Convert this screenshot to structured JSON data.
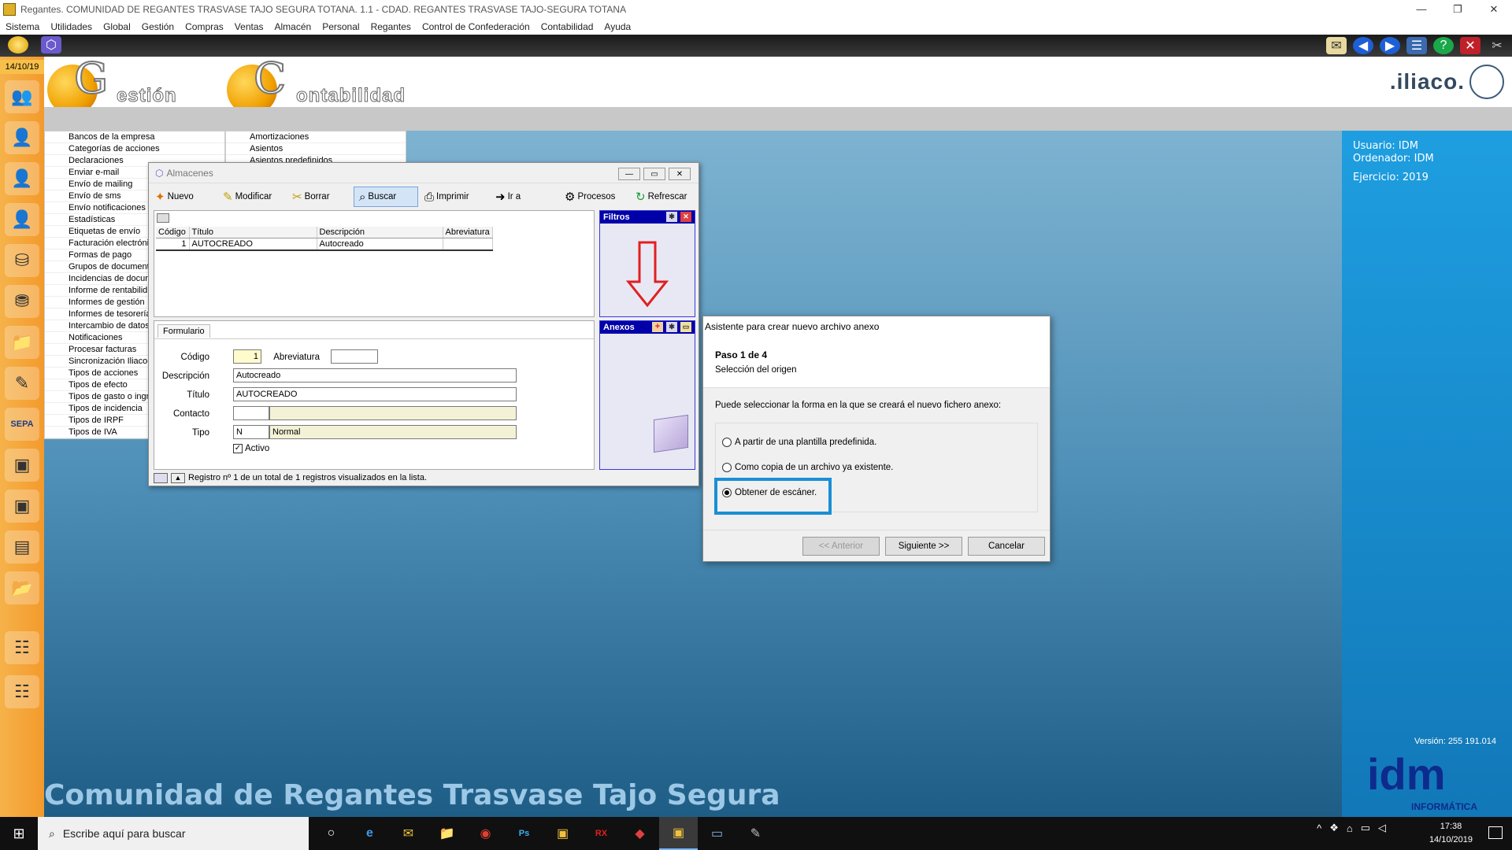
{
  "window": {
    "title": "Regantes. COMUNIDAD DE REGANTES TRASVASE TAJO SEGURA TOTANA. 1.1 - CDAD. REGANTES TRASVASE TAJO-SEGURA TOTANA",
    "minimize": "—",
    "restore": "❐",
    "close": "✕"
  },
  "menubar": [
    "Sistema",
    "Utilidades",
    "Global",
    "Gestión",
    "Compras",
    "Ventas",
    "Almacén",
    "Personal",
    "Regantes",
    "Control de Confederación",
    "Contabilidad",
    "Ayuda"
  ],
  "sidebar": {
    "date": "14/10/19",
    "icons": [
      "users-icon",
      "user-a-icon",
      "user-icon",
      "user-icon",
      "cylinder-icon",
      "database-icon",
      "folder-f-icon",
      "pencil-icon",
      "sepa-icon",
      "box-icon",
      "box-icon",
      "fc-icon",
      "folder-icon",
      "list-icon",
      "list-icon"
    ],
    "sepa_label": "SEPA"
  },
  "header": {
    "gestion_letter": "G",
    "gestion_word": "estión",
    "contab_letter": "C",
    "contab_word": "ontabilidad",
    "brand": ".iliaco."
  },
  "rightpanel": {
    "usuario": "Usuario: IDM",
    "ordenador": "Ordenador: IDM",
    "ejercicio": "Ejercicio: 2019",
    "version": "Versión: 255 191.014",
    "idm": "idm",
    "informatica": "INFORMÁTICA"
  },
  "banner": "Comunidad de Regantes Trasvase Tajo Segura",
  "menulist": {
    "col1": [
      "Bancos de la empresa",
      "Categorías de acciones",
      "Declaraciones",
      "Enviar e-mail",
      "Envío de mailing",
      "Envío de sms",
      "Envío notificaciones",
      "Estadísticas",
      "Etiquetas de envío",
      "Facturación electróni",
      "Formas de pago",
      "Grupos de document",
      "Incidencias de docun",
      "Informe de rentabilid",
      "Informes de gestión",
      "Informes de tesorería",
      "Intercambio de datos",
      "Notificaciones",
      "Procesar facturas",
      "Sincronización Iliaco-",
      "Tipos de acciones",
      "Tipos de efecto",
      "Tipos de gasto o ingr",
      "Tipos de incidencia",
      "Tipos de IRPF",
      "Tipos de IVA"
    ],
    "col2": [
      "Amortizaciones",
      "Asientos",
      "Asientos predefinidos"
    ]
  },
  "almacenes": {
    "title": "Almacenes",
    "toolbar": [
      {
        "label": "Nuevo",
        "icon": "new-icon"
      },
      {
        "label": "Modificar",
        "icon": "edit-icon"
      },
      {
        "label": "Borrar",
        "icon": "delete-icon"
      },
      {
        "label": "Buscar",
        "icon": "search-icon"
      },
      {
        "label": "Imprimir",
        "icon": "print-icon"
      },
      {
        "label": "Ir a",
        "icon": "goto-icon"
      },
      {
        "label": "Procesos",
        "icon": "gear-icon"
      },
      {
        "label": "Refrescar",
        "icon": "refresh-icon"
      }
    ],
    "grid": {
      "columns": [
        "Código",
        "Título",
        "Descripción",
        "Abreviatura"
      ],
      "rows": [
        [
          "1",
          "AUTOCREADO",
          "Autocreado",
          ""
        ]
      ]
    },
    "filtros": "Filtros",
    "anexos": "Anexos",
    "form": {
      "tab": "Formulario",
      "codigo_label": "Código",
      "codigo": "1",
      "abreviatura_label": "Abreviatura",
      "abreviatura": "",
      "descripcion_label": "Descripción",
      "descripcion": "Autocreado",
      "titulo_label": "Título",
      "titulo": "AUTOCREADO",
      "contacto_label": "Contacto",
      "contacto": "",
      "tipo_label": "Tipo",
      "tipo_code": "N",
      "tipo_name": "Normal",
      "activo_label": "Activo",
      "activo": true
    },
    "status": "Registro nº 1 de un total de 1 registros visualizados en la lista."
  },
  "wizard": {
    "title": "Asistente para crear nuevo archivo anexo",
    "step": "Paso 1 de 4",
    "subtitle": "Selección del origen",
    "description": "Puede seleccionar la forma en la que se creará el nuevo fichero anexo:",
    "options": [
      {
        "label": "A partir de una plantilla predefinida.",
        "selected": false
      },
      {
        "label": "Como copia de un archivo ya existente.",
        "selected": false
      },
      {
        "label": "Obtener de escáner.",
        "selected": true
      }
    ],
    "btn_prev": "<< Anterior",
    "btn_next": "Siguiente >>",
    "btn_cancel": "Cancelar"
  },
  "taskbar": {
    "search_placeholder": "Escribe aquí para buscar",
    "time": "17:38",
    "date": "14/10/2019"
  },
  "colors": {
    "sidebar": "#f39a2c",
    "accent_blue": "#1a8fd6",
    "panel_blue": "#1e9ee0"
  }
}
